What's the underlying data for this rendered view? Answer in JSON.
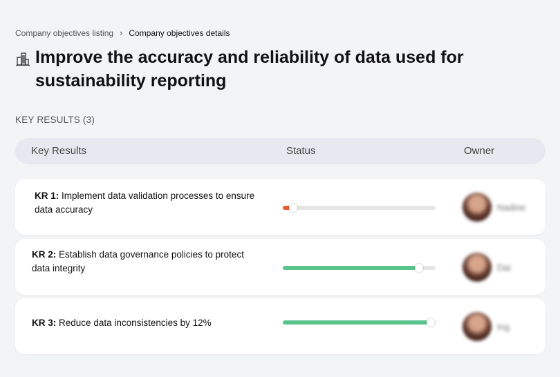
{
  "breadcrumb": {
    "parent": "Company objectives listing",
    "separator": "›",
    "current": "Company objectives details"
  },
  "objective": {
    "icon": "building-icon",
    "title": "Improve the accuracy and reliability of data used for sustainability reporting"
  },
  "key_results_section": {
    "label": "KEY RESULTS (3)",
    "columns": {
      "key_results": "Key Results",
      "status": "Status",
      "owner": "Owner"
    },
    "items": [
      {
        "prefix": "KR 1:",
        "text": "Implement data validation processes to ensure data accuracy",
        "progress": 0.07,
        "progress_color": "#ee5a36",
        "owner_name": "Nadine"
      },
      {
        "prefix": "KR 2:",
        "text": "Establish data governance policies to protect data integrity",
        "progress": 0.89,
        "progress_color": "#58c48c",
        "owner_name": "Dai"
      },
      {
        "prefix": "KR 3:",
        "text": "Reduce data inconsistencies by 12%",
        "progress": 0.97,
        "progress_color": "#58c48c",
        "owner_name": "Ing"
      }
    ]
  }
}
